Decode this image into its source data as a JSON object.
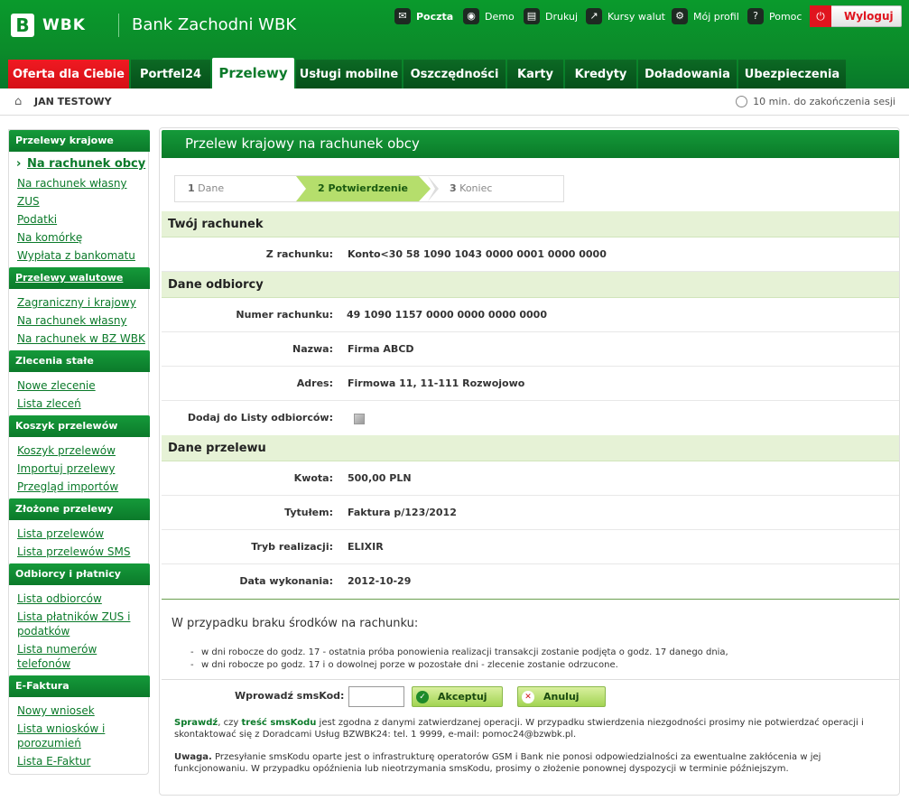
{
  "header": {
    "logo_mark": "B",
    "logo_text": "WBK",
    "bank_name": "Bank Zachodni WBK",
    "tools": [
      {
        "label": "Poczta",
        "icon": "mail-icon",
        "glyph": "✉"
      },
      {
        "label": "Demo",
        "icon": "demo-icon",
        "glyph": "◉"
      },
      {
        "label": "Drukuj",
        "icon": "print-icon",
        "glyph": "▤"
      },
      {
        "label": "Kursy walut",
        "icon": "chart-icon",
        "glyph": "↗"
      },
      {
        "label": "Mój profil",
        "icon": "profile-icon",
        "glyph": "⚙"
      },
      {
        "label": "Pomoc",
        "icon": "help-icon",
        "glyph": "?"
      }
    ],
    "logout_label": "Wyloguj"
  },
  "nav": {
    "tabs": [
      {
        "label": "Oferta dla Ciebie"
      },
      {
        "label": "Portfel24"
      },
      {
        "label": "Przelewy"
      },
      {
        "label": "Usługi mobilne"
      },
      {
        "label": "Oszczędności"
      },
      {
        "label": "Karty"
      },
      {
        "label": "Kredyty"
      },
      {
        "label": "Doładowania"
      },
      {
        "label": "Ubezpieczenia"
      }
    ]
  },
  "userbar": {
    "user_name": "JAN TESTOWY",
    "session": "10 min. do zakończenia sesji"
  },
  "sidebar": {
    "sections": [
      {
        "title": "Przelewy krajowe",
        "items": [
          "Na rachunek obcy",
          "Na rachunek własny",
          "ZUS",
          "Podatki",
          "Na komórkę",
          "Wypłata z bankomatu"
        ]
      },
      {
        "title": "Przelewy walutowe",
        "items": [
          "Zagraniczny i krajowy",
          "Na rachunek własny",
          "Na rachunek w BZ WBK"
        ]
      },
      {
        "title": "Zlecenia stałe",
        "items": [
          "Nowe zlecenie",
          "Lista zleceń"
        ]
      },
      {
        "title": "Koszyk przelewów",
        "items": [
          "Koszyk przelewów",
          "Importuj przelewy",
          "Przegląd importów"
        ]
      },
      {
        "title": "Złożone przelewy",
        "items": [
          "Lista przelewów",
          "Lista przelewów SMS"
        ]
      },
      {
        "title": "Odbiorcy i płatnicy",
        "items": [
          "Lista odbiorców",
          "Lista płatników ZUS i",
          "podatków",
          "Lista numerów",
          "telefonów"
        ]
      },
      {
        "title": "E-Faktura",
        "items": [
          "Nowy wniosek",
          "Lista wniosków i",
          "porozumień",
          "Lista E-Faktur"
        ]
      }
    ]
  },
  "main": {
    "title": "Przelew krajowy na rachunek obcy",
    "steps": [
      {
        "num": "1",
        "label": "Dane"
      },
      {
        "num": "2",
        "label": "Potwierdzenie"
      },
      {
        "num": "3",
        "label": "Koniec"
      }
    ],
    "sections": {
      "account": "Twój rachunek",
      "recipient": "Dane odbiorcy",
      "transfer": "Dane przelewu"
    },
    "fields": {
      "from_label": "Z rachunku:",
      "from_value": "Konto<30 58 1090 1043 0000 0001 0000 0000",
      "acc_label": "Numer rachunku:",
      "acc_value": "49 1090 1157 0000 0000 0000 0000",
      "name_label": "Nazwa:",
      "name_value": "Firma ABCD",
      "addr_label": "Adres:",
      "addr_value": "Firmowa 11, 11-111 Rozwojowo",
      "add_label": "Dodaj do Listy odbiorców:",
      "amount_label": "Kwota:",
      "amount_value": "500,00 PLN",
      "title_label": "Tytułem:",
      "title_value": "Faktura p/123/2012",
      "mode_label": "Tryb realizacji:",
      "mode_value": "ELIXIR",
      "date_label": "Data wykonania:",
      "date_value": "2012-10-29"
    },
    "warning": {
      "head": "W przypadku braku środków na rachunku:",
      "bullets": [
        "w dni robocze do godz. 17 - ostatnia próba ponowienia realizacji transakcji zostanie podjęta o godz. 17 danego dnia,",
        "w dni robocze po godz. 17 i o dowolnej porze w pozostałe dni - zlecenie zostanie odrzucone."
      ]
    },
    "sms": {
      "label": "Wprowadź smsKod:",
      "accept": "Akceptuj",
      "cancel": "Anuluj"
    },
    "notice1": {
      "check": "Sprawdź",
      "part1": ", czy ",
      "code": "treść smsKodu",
      "part2": " jest zgodna z danymi zatwierdzanej operacji. W przypadku stwierdzenia niezgodności prosimy nie potwierdzać operacji i skontaktować się z Doradcami Usług BZWBK24: tel. 1 9999, e-mail: pomoc24@bzwbk.pl."
    },
    "notice2": {
      "label": "Uwaga.",
      "text": " Przesyłanie smsKodu oparte jest o infrastrukturę operatorów GSM i Bank nie ponosi odpowiedzialności za ewentualne zakłócenia w jej funkcjonowaniu. W przypadku opóźnienia lub nieotrzymania smsKodu, prosimy o złożenie ponownej dyspozycji w terminie późniejszym."
    }
  },
  "colors": {
    "brand_green": "#0b8a2a",
    "accent_red": "#e0141e",
    "band_green": "#e6f2d6"
  }
}
